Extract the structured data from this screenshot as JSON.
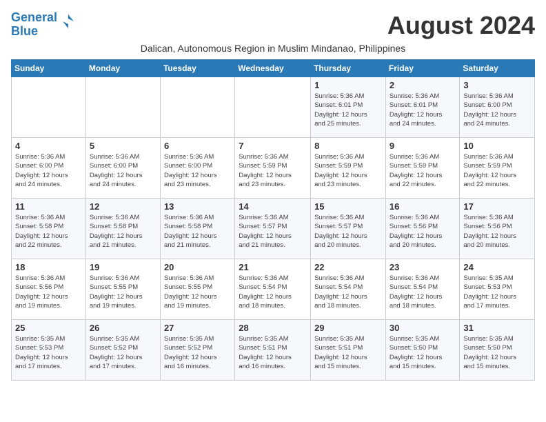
{
  "header": {
    "logo_line1": "General",
    "logo_line2": "Blue",
    "month_year": "August 2024",
    "subtitle": "Dalican, Autonomous Region in Muslim Mindanao, Philippines"
  },
  "days_of_week": [
    "Sunday",
    "Monday",
    "Tuesday",
    "Wednesday",
    "Thursday",
    "Friday",
    "Saturday"
  ],
  "weeks": [
    [
      {
        "day": "",
        "info": ""
      },
      {
        "day": "",
        "info": ""
      },
      {
        "day": "",
        "info": ""
      },
      {
        "day": "",
        "info": ""
      },
      {
        "day": "1",
        "info": "Sunrise: 5:36 AM\nSunset: 6:01 PM\nDaylight: 12 hours\nand 25 minutes."
      },
      {
        "day": "2",
        "info": "Sunrise: 5:36 AM\nSunset: 6:01 PM\nDaylight: 12 hours\nand 24 minutes."
      },
      {
        "day": "3",
        "info": "Sunrise: 5:36 AM\nSunset: 6:00 PM\nDaylight: 12 hours\nand 24 minutes."
      }
    ],
    [
      {
        "day": "4",
        "info": "Sunrise: 5:36 AM\nSunset: 6:00 PM\nDaylight: 12 hours\nand 24 minutes."
      },
      {
        "day": "5",
        "info": "Sunrise: 5:36 AM\nSunset: 6:00 PM\nDaylight: 12 hours\nand 24 minutes."
      },
      {
        "day": "6",
        "info": "Sunrise: 5:36 AM\nSunset: 6:00 PM\nDaylight: 12 hours\nand 23 minutes."
      },
      {
        "day": "7",
        "info": "Sunrise: 5:36 AM\nSunset: 5:59 PM\nDaylight: 12 hours\nand 23 minutes."
      },
      {
        "day": "8",
        "info": "Sunrise: 5:36 AM\nSunset: 5:59 PM\nDaylight: 12 hours\nand 23 minutes."
      },
      {
        "day": "9",
        "info": "Sunrise: 5:36 AM\nSunset: 5:59 PM\nDaylight: 12 hours\nand 22 minutes."
      },
      {
        "day": "10",
        "info": "Sunrise: 5:36 AM\nSunset: 5:59 PM\nDaylight: 12 hours\nand 22 minutes."
      }
    ],
    [
      {
        "day": "11",
        "info": "Sunrise: 5:36 AM\nSunset: 5:58 PM\nDaylight: 12 hours\nand 22 minutes."
      },
      {
        "day": "12",
        "info": "Sunrise: 5:36 AM\nSunset: 5:58 PM\nDaylight: 12 hours\nand 21 minutes."
      },
      {
        "day": "13",
        "info": "Sunrise: 5:36 AM\nSunset: 5:58 PM\nDaylight: 12 hours\nand 21 minutes."
      },
      {
        "day": "14",
        "info": "Sunrise: 5:36 AM\nSunset: 5:57 PM\nDaylight: 12 hours\nand 21 minutes."
      },
      {
        "day": "15",
        "info": "Sunrise: 5:36 AM\nSunset: 5:57 PM\nDaylight: 12 hours\nand 20 minutes."
      },
      {
        "day": "16",
        "info": "Sunrise: 5:36 AM\nSunset: 5:56 PM\nDaylight: 12 hours\nand 20 minutes."
      },
      {
        "day": "17",
        "info": "Sunrise: 5:36 AM\nSunset: 5:56 PM\nDaylight: 12 hours\nand 20 minutes."
      }
    ],
    [
      {
        "day": "18",
        "info": "Sunrise: 5:36 AM\nSunset: 5:56 PM\nDaylight: 12 hours\nand 19 minutes."
      },
      {
        "day": "19",
        "info": "Sunrise: 5:36 AM\nSunset: 5:55 PM\nDaylight: 12 hours\nand 19 minutes."
      },
      {
        "day": "20",
        "info": "Sunrise: 5:36 AM\nSunset: 5:55 PM\nDaylight: 12 hours\nand 19 minutes."
      },
      {
        "day": "21",
        "info": "Sunrise: 5:36 AM\nSunset: 5:54 PM\nDaylight: 12 hours\nand 18 minutes."
      },
      {
        "day": "22",
        "info": "Sunrise: 5:36 AM\nSunset: 5:54 PM\nDaylight: 12 hours\nand 18 minutes."
      },
      {
        "day": "23",
        "info": "Sunrise: 5:36 AM\nSunset: 5:54 PM\nDaylight: 12 hours\nand 18 minutes."
      },
      {
        "day": "24",
        "info": "Sunrise: 5:35 AM\nSunset: 5:53 PM\nDaylight: 12 hours\nand 17 minutes."
      }
    ],
    [
      {
        "day": "25",
        "info": "Sunrise: 5:35 AM\nSunset: 5:53 PM\nDaylight: 12 hours\nand 17 minutes."
      },
      {
        "day": "26",
        "info": "Sunrise: 5:35 AM\nSunset: 5:52 PM\nDaylight: 12 hours\nand 17 minutes."
      },
      {
        "day": "27",
        "info": "Sunrise: 5:35 AM\nSunset: 5:52 PM\nDaylight: 12 hours\nand 16 minutes."
      },
      {
        "day": "28",
        "info": "Sunrise: 5:35 AM\nSunset: 5:51 PM\nDaylight: 12 hours\nand 16 minutes."
      },
      {
        "day": "29",
        "info": "Sunrise: 5:35 AM\nSunset: 5:51 PM\nDaylight: 12 hours\nand 15 minutes."
      },
      {
        "day": "30",
        "info": "Sunrise: 5:35 AM\nSunset: 5:50 PM\nDaylight: 12 hours\nand 15 minutes."
      },
      {
        "day": "31",
        "info": "Sunrise: 5:35 AM\nSunset: 5:50 PM\nDaylight: 12 hours\nand 15 minutes."
      }
    ]
  ]
}
